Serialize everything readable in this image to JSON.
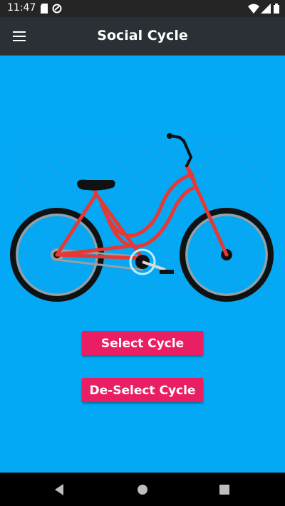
{
  "status_bar": {
    "time": "11:47",
    "left_icons": [
      "sd-card-icon",
      "sync-icon"
    ],
    "right_icons": [
      "wifi-icon",
      "signal-icon",
      "battery-icon"
    ]
  },
  "app_bar": {
    "title": "Social Cycle",
    "menu_icon": "hamburger-menu-icon"
  },
  "main": {
    "image": "bicycle-illustration",
    "buttons": {
      "select": "Select Cycle",
      "deselect": "De-Select Cycle"
    }
  },
  "nav_bar": {
    "buttons": [
      "back-icon",
      "home-icon",
      "recents-icon"
    ]
  },
  "colors": {
    "background": "#03A9F4",
    "app_bar": "#2B3036",
    "accent": "#E91E63",
    "bike_frame": "#E53935"
  }
}
